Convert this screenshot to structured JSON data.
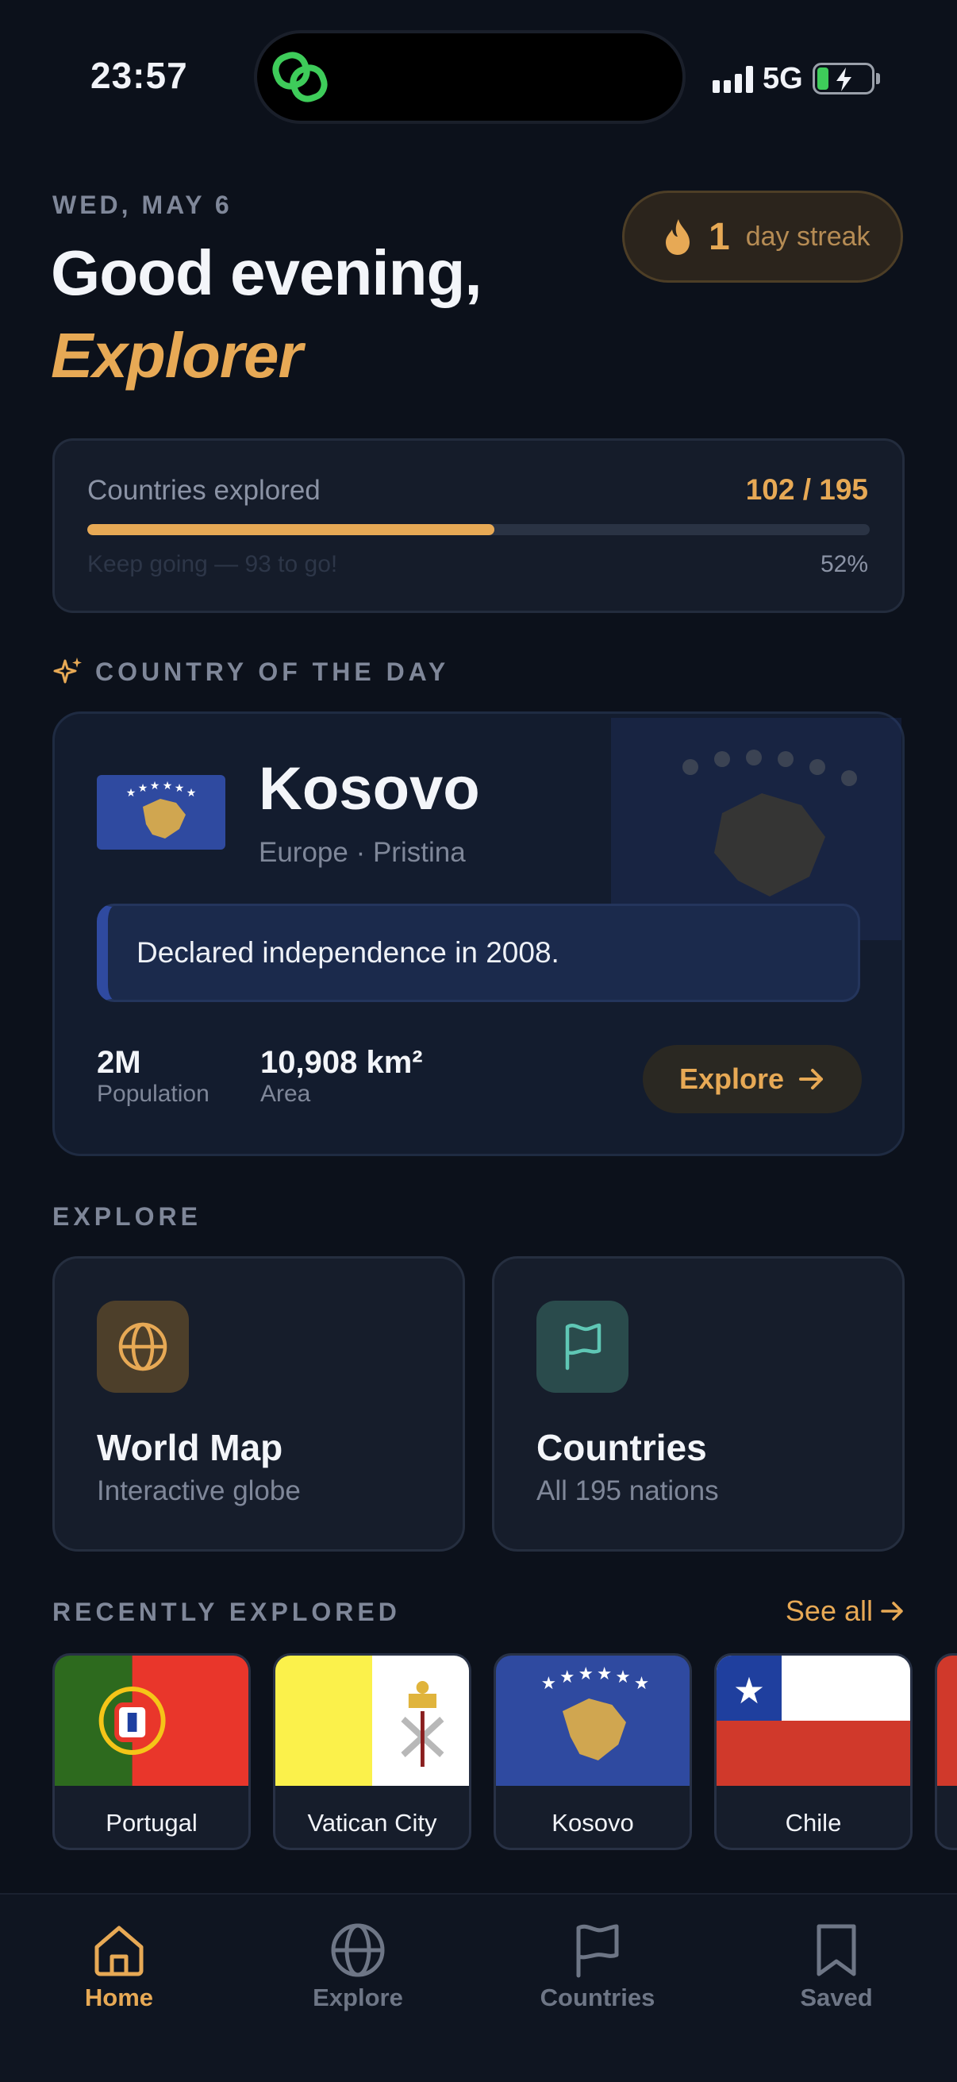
{
  "status": {
    "time": "23:57",
    "network": "5G"
  },
  "header": {
    "date": "WED, MAY 6",
    "greeting": "Good evening,",
    "name": "Explorer",
    "streak": {
      "count": "1",
      "label": "day streak"
    }
  },
  "progress": {
    "label": "Countries explored",
    "count": "102 / 195",
    "fraction": 0.52,
    "note": "Keep going — 93 to go!",
    "percent": "52%"
  },
  "country_of_day": {
    "heading": "COUNTRY OF THE DAY",
    "name": "Kosovo",
    "meta": "Europe · Pristina",
    "fact": "Declared independence in 2008.",
    "stats": [
      {
        "value": "2M",
        "label": "Population"
      },
      {
        "value": "10,908 km²",
        "label": "Area"
      }
    ],
    "button": "Explore",
    "colors": {
      "flag_blue": "#2f4aa0",
      "flag_gold": "#d0a650"
    }
  },
  "explore": {
    "heading": "EXPLORE",
    "tiles": [
      {
        "title": "World Map",
        "subtitle": "Interactive globe",
        "icon": "globe-icon"
      },
      {
        "title": "Countries",
        "subtitle": "All 195 nations",
        "icon": "flag-icon"
      }
    ]
  },
  "recent": {
    "heading": "RECENTLY EXPLORED",
    "see_all": "See all",
    "items": [
      {
        "name": "Portugal"
      },
      {
        "name": "Vatican City"
      },
      {
        "name": "Kosovo"
      },
      {
        "name": "Chile"
      }
    ]
  },
  "nav": {
    "items": [
      {
        "label": "Home",
        "icon": "home-icon",
        "active": true
      },
      {
        "label": "Explore",
        "icon": "globe-icon"
      },
      {
        "label": "Countries",
        "icon": "flag-icon"
      },
      {
        "label": "Saved",
        "icon": "bookmark-icon"
      }
    ]
  },
  "colors": {
    "accent": "#e7a955",
    "background": "#0c111b"
  }
}
